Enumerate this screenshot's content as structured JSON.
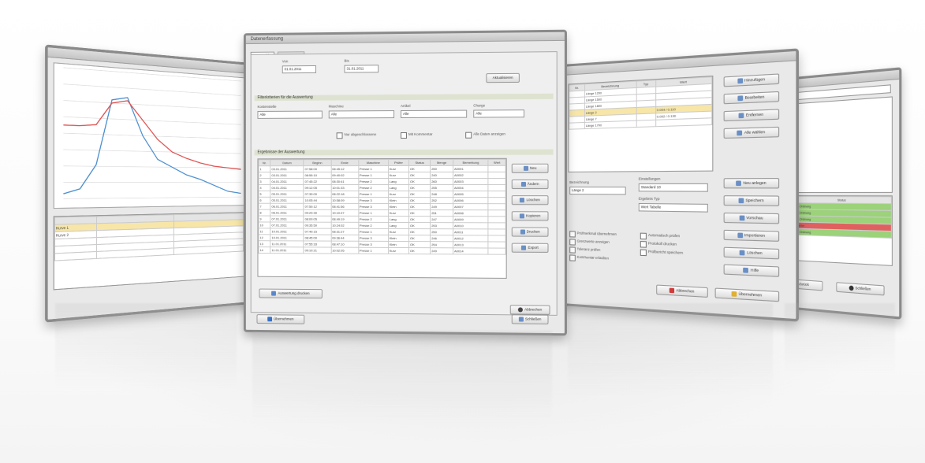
{
  "chart_window": {
    "legend_rows": [
      "Kurve 1",
      "Kurve 2"
    ]
  },
  "main_window": {
    "title": "Datenerfassung",
    "tabs": [
      "Auswahl",
      "Parameter"
    ],
    "date_from_label": "Von",
    "date_to_label": "Bis",
    "date_from_value": "01.01.2011",
    "date_to_value": "31.01.2011",
    "refresh_button": "Aktualisieren",
    "filter_section": "Filterkriterien für die Auswertung",
    "filter_labels": [
      "Kostenstelle",
      "Maschine",
      "Artikel",
      "Charge"
    ],
    "filter_values": [
      "Alle",
      "Alle",
      "Alle",
      "Alle"
    ],
    "checkbox_labels": [
      "Nur abgeschlossene",
      "Mit Kommentar",
      "Alle Daten anzeigen"
    ],
    "results_section": "Ergebnisse der Auswertung",
    "table_headers": [
      "Nr.",
      "Datum",
      "Beginn",
      "Ende",
      "Maschine",
      "Prüfer",
      "Status",
      "Menge",
      "Bemerkung",
      "Wert"
    ],
    "table_rows": [
      [
        "1",
        "03.01.2011",
        "07:58:00",
        "08:45:12",
        "Presse 1",
        "Kurz",
        "OK",
        "250",
        "A0001"
      ],
      [
        "2",
        "03.01.2011",
        "08:55:10",
        "09:40:02",
        "Presse 1",
        "Kurz",
        "OK",
        "240",
        "A0002"
      ],
      [
        "3",
        "04.01.2011",
        "07:45:22",
        "08:30:41",
        "Presse 2",
        "Lang",
        "OK",
        "260",
        "A0003"
      ],
      [
        "4",
        "04.01.2011",
        "09:12:05",
        "10:01:33",
        "Presse 2",
        "Lang",
        "OK",
        "255",
        "A0004"
      ],
      [
        "5",
        "05.01.2011",
        "07:30:00",
        "08:22:18",
        "Presse 1",
        "Kurz",
        "OK",
        "248",
        "A0005"
      ],
      [
        "6",
        "05.01.2011",
        "10:05:44",
        "10:58:09",
        "Presse 3",
        "Klein",
        "OK",
        "252",
        "A0006"
      ],
      [
        "7",
        "06.01.2011",
        "07:50:12",
        "08:41:56",
        "Presse 3",
        "Klein",
        "OK",
        "249",
        "A0007"
      ],
      [
        "8",
        "06.01.2011",
        "09:20:30",
        "10:10:47",
        "Presse 1",
        "Kurz",
        "OK",
        "251",
        "A0008"
      ],
      [
        "9",
        "07.01.2011",
        "08:00:05",
        "08:49:19",
        "Presse 2",
        "Lang",
        "OK",
        "247",
        "A0009"
      ],
      [
        "10",
        "07.01.2011",
        "09:35:50",
        "10:24:02",
        "Presse 2",
        "Lang",
        "OK",
        "253",
        "A0010"
      ],
      [
        "11",
        "10.01.2011",
        "07:40:15",
        "08:31:27",
        "Presse 1",
        "Kurz",
        "OK",
        "250",
        "A0011"
      ],
      [
        "12",
        "10.01.2011",
        "08:45:00",
        "09:36:44",
        "Presse 3",
        "Klein",
        "OK",
        "246",
        "A0012"
      ],
      [
        "13",
        "11.01.2011",
        "07:55:33",
        "08:47:10",
        "Presse 3",
        "Klein",
        "OK",
        "254",
        "A0013"
      ],
      [
        "14",
        "11.01.2011",
        "09:10:21",
        "10:02:05",
        "Presse 1",
        "Kurz",
        "OK",
        "249",
        "A0014"
      ]
    ],
    "side_buttons": [
      "Neu",
      "Ändern",
      "Löschen",
      "Kopieren",
      "Drucken",
      "Export",
      "Schließen"
    ],
    "footer_button_left": "Auswertung drucken",
    "footer_button_bottom": "Übernehmen",
    "footer_button_right": "Abbrechen"
  },
  "right_window": {
    "grid_headers": [
      "Nr.",
      "Bezeichnung",
      "Typ",
      "Wert"
    ],
    "grid_rows": [
      [
        "",
        "Länge 1200",
        "",
        ""
      ],
      [
        "",
        "Länge 1500",
        "",
        ""
      ],
      [
        "",
        "Länge 1800",
        "",
        ""
      ],
      [
        "",
        "Länge 2",
        "",
        "0.004 / 0.110"
      ],
      [
        "",
        "Länge 7",
        "",
        "0.002 / 0.130"
      ],
      [
        "",
        "Länge 1700",
        "",
        ""
      ]
    ],
    "top_buttons": [
      "Hinzufügen",
      "Bearbeiten",
      "Entfernen",
      "Alle wählen"
    ],
    "label_left": "Bezeichnung",
    "field_left": "Länge 2",
    "label_mid1": "Einstellungen",
    "field_mid1": "Standard 10",
    "label_mid2": "Ergebnis Typ",
    "field_mid2": "Wert Tabelle",
    "mid_buttons": [
      "Neu anlegen",
      "Speichern",
      "Vorschau",
      "Importieren",
      "Löschen",
      "Hilfe"
    ],
    "checkboxes_left": [
      "Prüfmerkmal übernehmen",
      "Grenzwerte anzeigen",
      "Toleranz prüfen",
      "Kommentar erlauben"
    ],
    "checkboxes_right": [
      "Automatisch prüfen",
      "Protokoll drucken",
      "Prüfbericht speichern"
    ],
    "cancel_button": "Abbrechen",
    "ok_button": "Übernehmen"
  },
  "far_right_window": {
    "status_header": "Status",
    "statuses": [
      "In Ordnung",
      "In Ordnung",
      "In Ordnung",
      "Fehler",
      "In Ordnung"
    ],
    "status_colors": [
      "#9bd27a",
      "#9bd27a",
      "#9bd27a",
      "#e06060",
      "#9bd27a"
    ],
    "button_left": "Zurück",
    "button_right": "Schließen"
  },
  "chart_data": {
    "type": "line",
    "series": [
      {
        "values": [
          30,
          60,
          210,
          620,
          640,
          400,
          250,
          200,
          150,
          120,
          80,
          40,
          25
        ]
      },
      {
        "values": [
          450,
          450,
          460,
          600,
          620,
          500,
          380,
          300,
          260,
          230,
          210,
          200,
          190
        ]
      }
    ],
    "ylim": [
      0,
      800
    ]
  }
}
